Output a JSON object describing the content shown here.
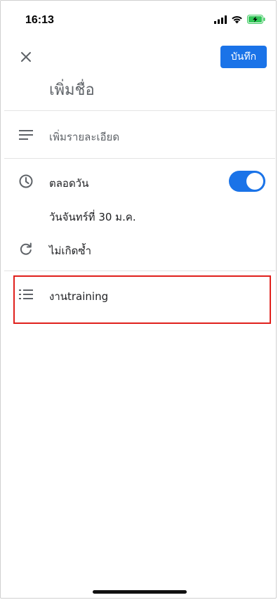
{
  "status_bar": {
    "time": "16:13"
  },
  "header": {
    "save_label": "บันทึก",
    "title_placeholder": "เพิ่มชื่อ"
  },
  "rows": {
    "description": "เพิ่มรายละเอียด",
    "all_day": "ตลอดวัน",
    "date": "วันจันทร์ที่ 30 ม.ค.",
    "repeat": "ไม่เกิดซ้ำ",
    "task_list": "งานtraining"
  },
  "toggle": {
    "all_day_on": true
  },
  "colors": {
    "accent": "#1a73e8",
    "highlight": "#e0201c",
    "battery": "#34c759"
  },
  "icons": {
    "close": "close-icon",
    "notes": "notes-icon",
    "clock": "clock-icon",
    "repeat": "repeat-icon",
    "list": "list-icon"
  }
}
